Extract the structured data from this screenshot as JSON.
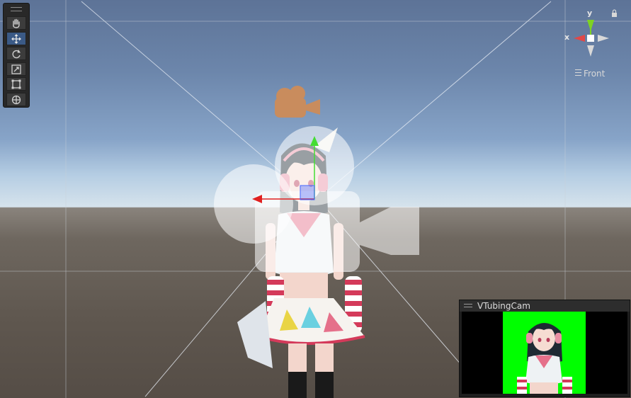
{
  "toolbar": {
    "tools": [
      {
        "name": "hand-tool",
        "icon": "hand-icon",
        "active": false
      },
      {
        "name": "move-tool",
        "icon": "move-arrows-icon",
        "active": true
      },
      {
        "name": "rotate-tool",
        "icon": "rotate-icon",
        "active": false
      },
      {
        "name": "scale-tool",
        "icon": "scale-icon",
        "active": false
      },
      {
        "name": "rect-tool",
        "icon": "rect-transform-icon",
        "active": false
      },
      {
        "name": "transform-tool",
        "icon": "transform-icon",
        "active": false
      }
    ]
  },
  "orientation_gizmo": {
    "y_label": "y",
    "x_label": "x",
    "view_label": "Front",
    "lock_icon": "lock-icon",
    "colors": {
      "y": "#7ed321",
      "x": "#e04848",
      "neutral": "#d8d8d8"
    }
  },
  "camera_preview": {
    "title": "VTubingCam",
    "background_color": "#00ff00"
  },
  "scene": {
    "camera_gizmo_color": "#c98c5d",
    "move_handle_colors": {
      "x": "#e02020",
      "y": "#44dd33",
      "z": "#3355ff"
    }
  }
}
